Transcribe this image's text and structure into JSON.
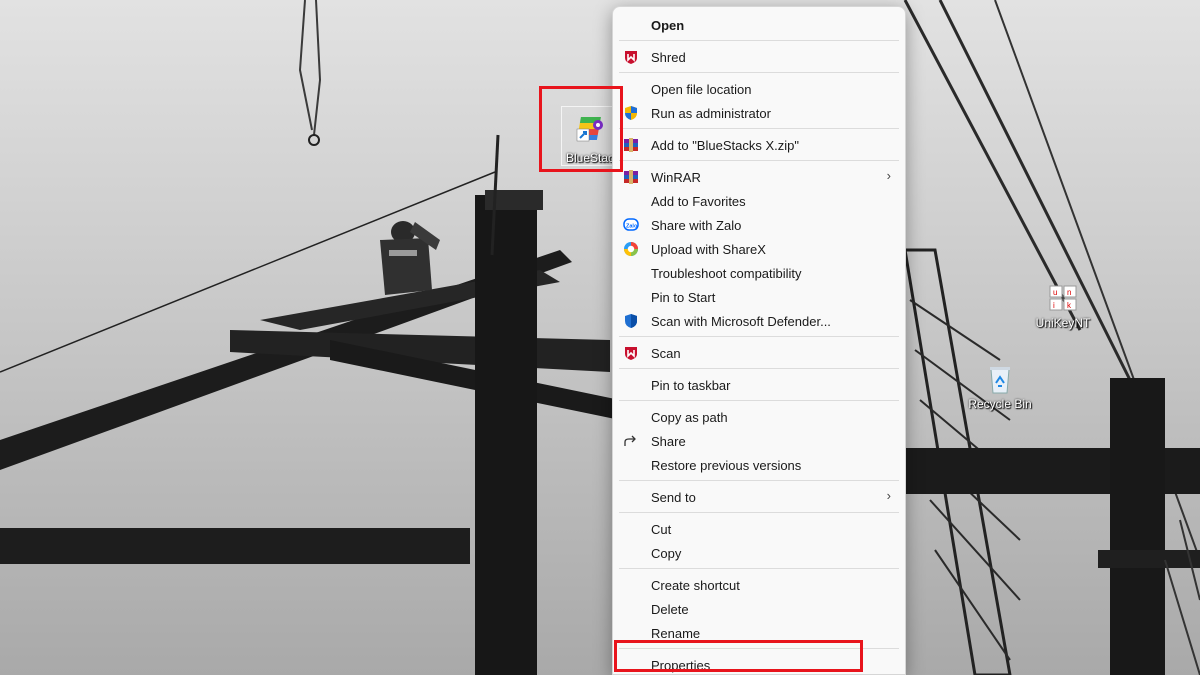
{
  "desktop": {
    "icons": [
      {
        "label": "BlueStac",
        "icon": "bluestacks-shortcut-icon"
      },
      {
        "label": "UniKeyNT",
        "icon": "unikey-icon"
      },
      {
        "label": "Recycle Bin",
        "icon": "recycle-bin-icon"
      }
    ]
  },
  "context_menu": {
    "groups": [
      [
        {
          "label": "Open",
          "bold": true
        }
      ],
      [
        {
          "label": "Shred",
          "icon": "mcafee-icon"
        }
      ],
      [
        {
          "label": "Open file location"
        },
        {
          "label": "Run as administrator",
          "icon": "uac-shield-icon"
        }
      ],
      [
        {
          "label": "Add to \"BlueStacks X.zip\"",
          "icon": "winrar-archive-icon"
        }
      ],
      [
        {
          "label": "WinRAR",
          "icon": "winrar-icon",
          "submenu": true
        },
        {
          "label": "Add to Favorites"
        },
        {
          "label": "Share with Zalo",
          "icon": "zalo-icon"
        },
        {
          "label": "Upload with ShareX",
          "icon": "sharex-icon"
        },
        {
          "label": "Troubleshoot compatibility"
        },
        {
          "label": "Pin to Start"
        },
        {
          "label": "Scan with Microsoft Defender...",
          "icon": "defender-shield-icon"
        }
      ],
      [
        {
          "label": "Scan",
          "icon": "mcafee-icon"
        }
      ],
      [
        {
          "label": "Pin to taskbar"
        }
      ],
      [
        {
          "label": "Copy as path"
        },
        {
          "label": "Share",
          "icon": "share-icon"
        },
        {
          "label": "Restore previous versions"
        }
      ],
      [
        {
          "label": "Send to",
          "submenu": true
        }
      ],
      [
        {
          "label": "Cut"
        },
        {
          "label": "Copy"
        }
      ],
      [
        {
          "label": "Create shortcut"
        },
        {
          "label": "Delete"
        },
        {
          "label": "Rename"
        }
      ],
      [
        {
          "label": "Properties",
          "highlighted": true
        }
      ]
    ],
    "submenu_arrow": "›"
  },
  "colors": {
    "highlight": "#e8141c",
    "menu_bg": "#f9f9f9",
    "mcafee": "#c8102e",
    "defender": "#1f6fd1"
  }
}
